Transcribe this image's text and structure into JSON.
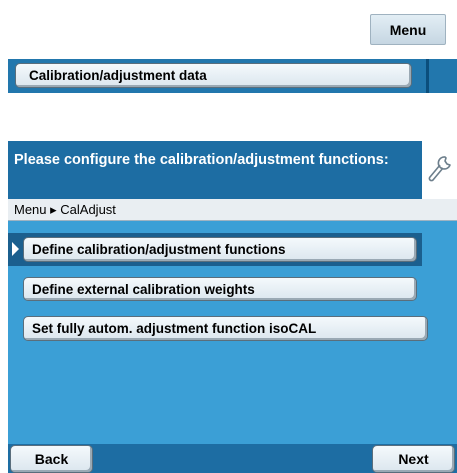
{
  "top": {
    "menu_label": "Menu",
    "calibration_data_label": "Calibration/adjustment data"
  },
  "panel": {
    "title": "Please configure the calibration/adjustment functions:",
    "wrench_icon": "wrench-icon",
    "breadcrumb": "Menu ▸ CalAdjust",
    "options": [
      "Define calibration/adjustment functions",
      "Define external calibration weights",
      "Set fully autom. adjustment function isoCAL"
    ],
    "selected_index": 0,
    "back_label": "Back",
    "next_label": "Next"
  },
  "colors": {
    "header_blue": "#1d6da3",
    "panel_blue": "#3b9fd6",
    "button_face": "#e8f0f5"
  }
}
